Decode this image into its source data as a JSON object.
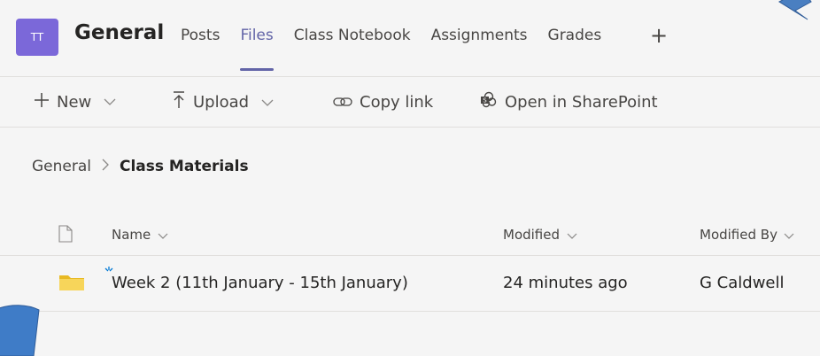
{
  "header": {
    "avatar_initials": "TT",
    "channel_title": "General",
    "tabs": [
      {
        "label": "Posts"
      },
      {
        "label": "Files"
      },
      {
        "label": "Class Notebook"
      },
      {
        "label": "Assignments"
      },
      {
        "label": "Grades"
      }
    ],
    "add_tab_glyph": "+",
    "accent_color": "#6264a7",
    "avatar_color": "#7b68d9"
  },
  "toolbar": {
    "new_label": "New",
    "upload_label": "Upload",
    "copy_link_label": "Copy link",
    "open_sharepoint_label": "Open in SharePoint"
  },
  "breadcrumb": {
    "root": "General",
    "current": "Class Materials"
  },
  "list": {
    "columns": {
      "name": "Name",
      "modified": "Modified",
      "modified_by": "Modified By"
    },
    "rows": [
      {
        "type": "folder",
        "name": "Week 2 (11th January - 15th January)",
        "modified": "24 minutes ago",
        "modified_by": "G Caldwell"
      }
    ]
  },
  "icons": {
    "new": "plus-icon",
    "upload": "upload-icon",
    "copy_link": "link-icon",
    "sharepoint": "sharepoint-icon",
    "folder": "folder-icon",
    "file_type": "file-icon"
  }
}
